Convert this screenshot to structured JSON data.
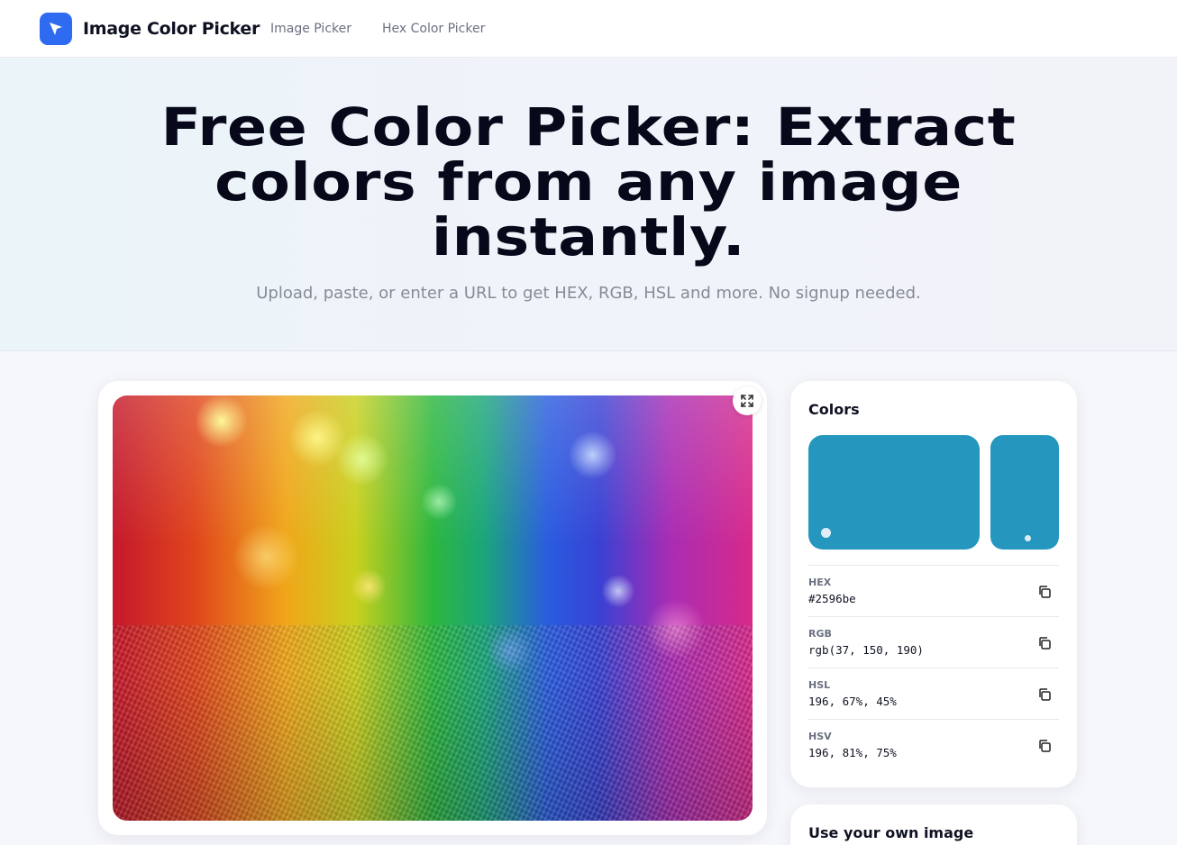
{
  "nav": {
    "brand": "Image Color Picker",
    "links": [
      {
        "label": "Image Picker"
      },
      {
        "label": "Hex Color Picker"
      }
    ]
  },
  "hero": {
    "title": "Free Color Picker: Extract colors from any image instantly.",
    "subtitle": "Upload, paste, or enter a URL to get HEX, RGB, HSL and more. No signup needed."
  },
  "colors": {
    "title": "Colors",
    "picked_color": "#2596be",
    "values": [
      {
        "label": "HEX",
        "value": "#2596be"
      },
      {
        "label": "RGB",
        "value": "rgb(37, 150, 190)"
      },
      {
        "label": "HSL",
        "value": "196, 67%, 45%"
      },
      {
        "label": "HSV",
        "value": "196, 81%, 75%"
      }
    ]
  },
  "own_image": {
    "title": "Use your own image"
  },
  "icons": {
    "logo": "cursor-arrow-icon",
    "expand": "expand-icon",
    "copy": "copy-icon"
  },
  "theme": {
    "accent": "#2f6bf0"
  }
}
